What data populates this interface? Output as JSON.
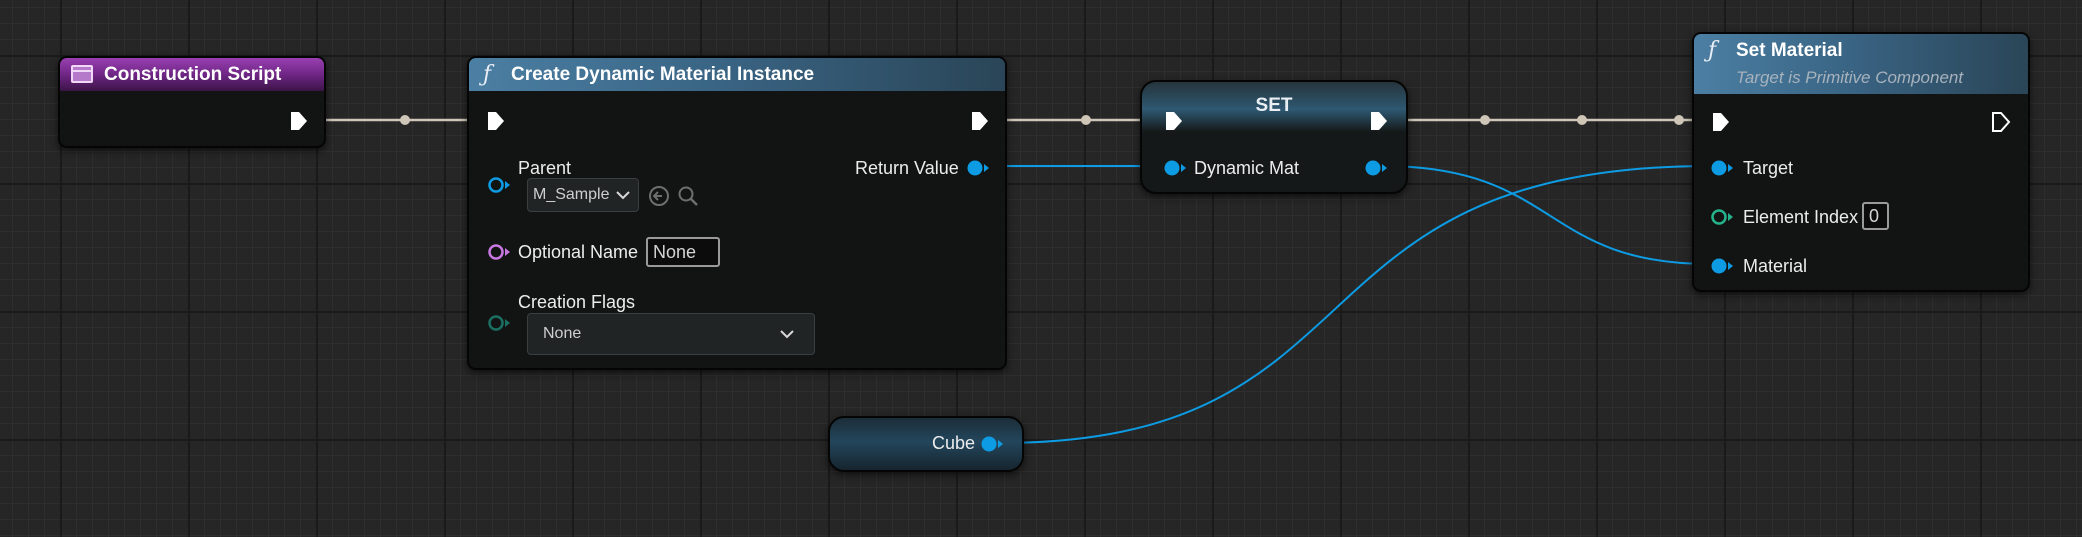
{
  "colors": {
    "exec_wire": "#cfc6b8",
    "object_wire": "#0d9be3",
    "object_pin": "#0d9be3",
    "string_pin": "#c778e0",
    "int_pin": "#25b38c",
    "byte_pin": "#1b6e62"
  },
  "nodes": {
    "construction_script": {
      "title": "Construction Script",
      "icon": "event-script-icon"
    },
    "create_dmi": {
      "title": "Create Dynamic Material Instance",
      "icon": "function-f-icon",
      "parent_label": "Parent",
      "parent_value": "M_Sample",
      "optional_name_label": "Optional Name",
      "optional_name_value": "None",
      "creation_flags_label": "Creation Flags",
      "creation_flags_value": "None",
      "return_value_label": "Return Value"
    },
    "set_node": {
      "title": "SET",
      "variable_label": "Dynamic Mat"
    },
    "set_material": {
      "title": "Set Material",
      "subtitle": "Target is Primitive Component",
      "icon": "function-f-icon",
      "target_label": "Target",
      "element_index_label": "Element Index",
      "element_index_value": "0",
      "material_label": "Material"
    },
    "cube_node": {
      "label": "Cube"
    }
  }
}
